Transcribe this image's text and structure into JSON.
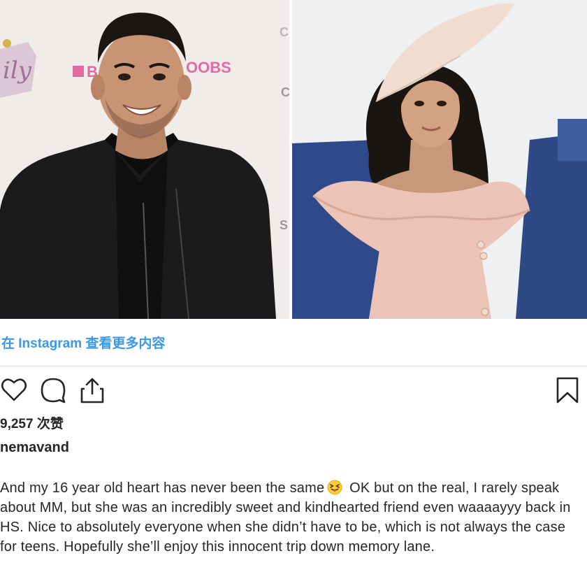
{
  "post": {
    "view_more_link": "在 Instagram 查看更多内容",
    "likes": "9,257 次赞",
    "username": "nemavand",
    "caption": {
      "part1": "And my 16 year old heart has never been the same",
      "emoji": "squinting-face-with-tongue",
      "part2": " OK but on the real, I rarely speak about MM, but she was an incredibly sweet and kindhearted friend even waaaayyy back in HS. Nice to absolutely everyone when she didn’t have to be, which is not always the case for teens. Hopefully she’ll enjoy this innocent trip down memory lane."
    },
    "backdrop_text": {
      "logo_fragment": "ily",
      "brand_fragment_1": "B",
      "brand_fragment_2": "OOBS",
      "letter_c": "C",
      "letter_c2": "C",
      "letter_s": "S"
    },
    "icons": {
      "like": "heart-icon",
      "comment": "comment-icon",
      "share": "share-icon",
      "save": "bookmark-icon"
    },
    "colors": {
      "link": "#3897f0",
      "text": "#262626",
      "divider": "#dbdbdb"
    }
  }
}
